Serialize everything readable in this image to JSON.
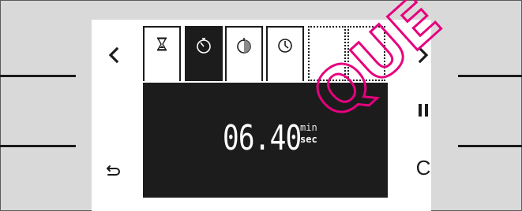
{
  "display": {
    "time_value": "06.40",
    "unit_min": "min",
    "unit_sec": "sec"
  },
  "tabs": [
    {
      "name": "hourglass-icon"
    },
    {
      "name": "stopwatch-icon"
    },
    {
      "name": "timer-duration-icon"
    },
    {
      "name": "clock-icon"
    }
  ],
  "controls": {
    "left": "left-arrow-icon",
    "right": "right-arrow-icon",
    "pause": "pause-icon",
    "back": "back-icon",
    "cancel": "C"
  },
  "watermark": {
    "text": "QUE",
    "color": "#e6007e"
  },
  "colors": {
    "screen": "#1c1c1c",
    "panel": "#ffffff",
    "bezel": "#d9d9d9",
    "accent": "#e6007e"
  }
}
